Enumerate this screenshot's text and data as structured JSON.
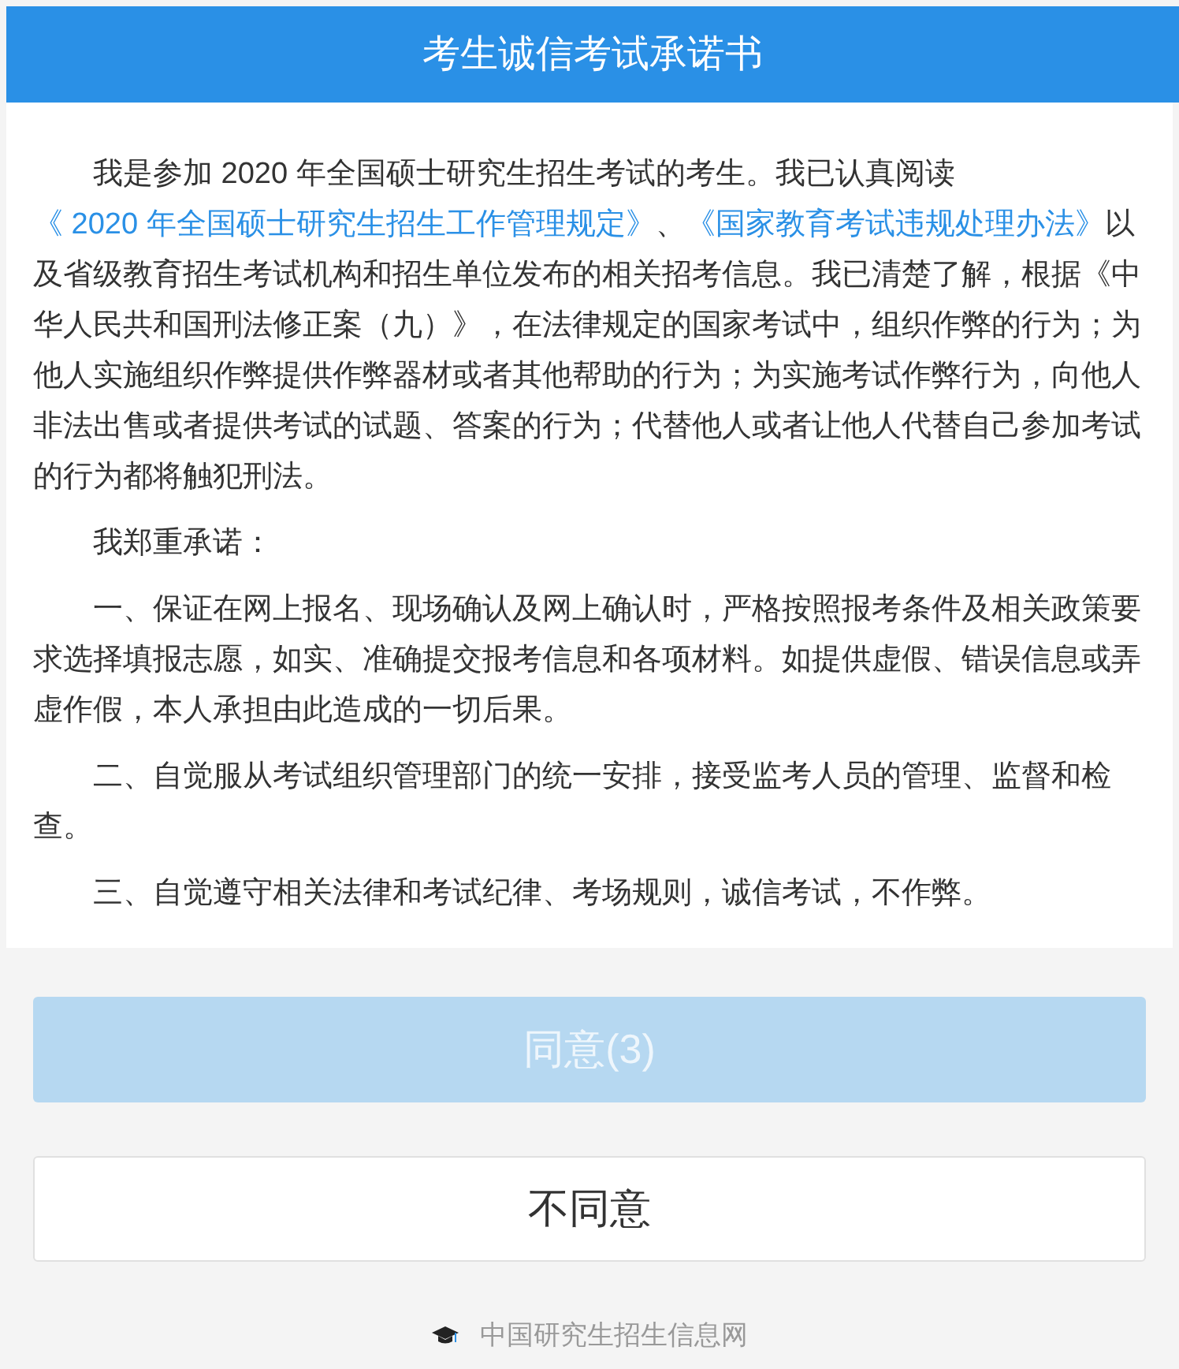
{
  "header": {
    "title": "考生诚信考试承诺书"
  },
  "paragraphs": [
    {
      "segments": [
        {
          "kind": "text",
          "text": "我是参加 2020 年全国硕士研究生招生考试的考生。我已认真阅读 "
        },
        {
          "kind": "link",
          "text": "《 2020 年全国硕士研究生招生工作管理规定》"
        },
        {
          "kind": "text",
          "text": "、"
        },
        {
          "kind": "link",
          "text": "《国家教育考试违规处理办法》"
        },
        {
          "kind": "text",
          "text": "以及省级教育招生考试机构和招生单位发布的相关招考信息。我已清楚了解，根据《中华人民共和国刑法修正案（九）》，在法律规定的国家考试中，组织作弊的行为；为他人实施组织作弊提供作弊器材或者其他帮助的行为；为实施考试作弊行为，向他人非法出售或者提供考试的试题、答案的行为；代替他人或者让他人代替自己参加考试的行为都将触犯刑法。"
        }
      ]
    },
    {
      "segments": [
        {
          "kind": "text",
          "text": "我郑重承诺："
        }
      ]
    },
    {
      "segments": [
        {
          "kind": "text",
          "text": "一、保证在网上报名、现场确认及网上确认时，严格按照报考条件及相关政策要求选择填报志愿，如实、准确提交报考信息和各项材料。如提供虚假、错误信息或弄虚作假，本人承担由此造成的一切后果。"
        }
      ]
    },
    {
      "segments": [
        {
          "kind": "text",
          "text": "二、自觉服从考试组织管理部门的统一安排，接受监考人员的管理、监督和检查。"
        }
      ]
    },
    {
      "segments": [
        {
          "kind": "text",
          "text": "三、自觉遵守相关法律和考试纪律、考场规则，诚信考试，不作弊。"
        }
      ]
    }
  ],
  "buttons": [
    {
      "kind": "primary",
      "label": "同意(3)",
      "disabled": true
    },
    {
      "kind": "secondary",
      "label": "不同意",
      "disabled": false
    }
  ],
  "footer": {
    "text": "中国研究生招生信息网"
  }
}
